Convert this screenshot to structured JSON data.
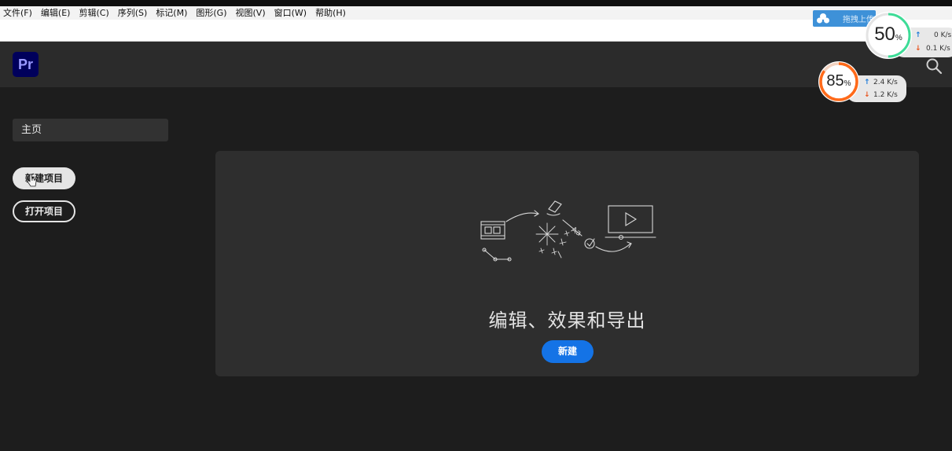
{
  "menubar": {
    "items": [
      "文件(F)",
      "编辑(E)",
      "剪辑(C)",
      "序列(S)",
      "标记(M)",
      "图形(G)",
      "视图(V)",
      "窗口(W)",
      "帮助(H)"
    ]
  },
  "header": {
    "logo_text": "Pr",
    "search_icon": "search-icon"
  },
  "sidebar": {
    "home_label": "主页",
    "new_project_label": "新建项目",
    "open_project_label": "打开项目"
  },
  "card": {
    "title": "编辑、效果和导出",
    "create_label": "新建"
  },
  "cloud": {
    "text": "拖拽上传"
  },
  "widgets": [
    {
      "percent": "50",
      "unit": "%",
      "up": "0 K/s",
      "down": "0.1 K/s",
      "color": "#3ddc97"
    },
    {
      "percent": "85",
      "unit": "%",
      "up": "2.4 K/s",
      "down": "1.2 K/s",
      "color": "#ff6a1a"
    }
  ],
  "colors": {
    "accent": "#1473e6",
    "pr_logo_bg": "#00005b",
    "pr_logo_text": "#9999ff"
  }
}
